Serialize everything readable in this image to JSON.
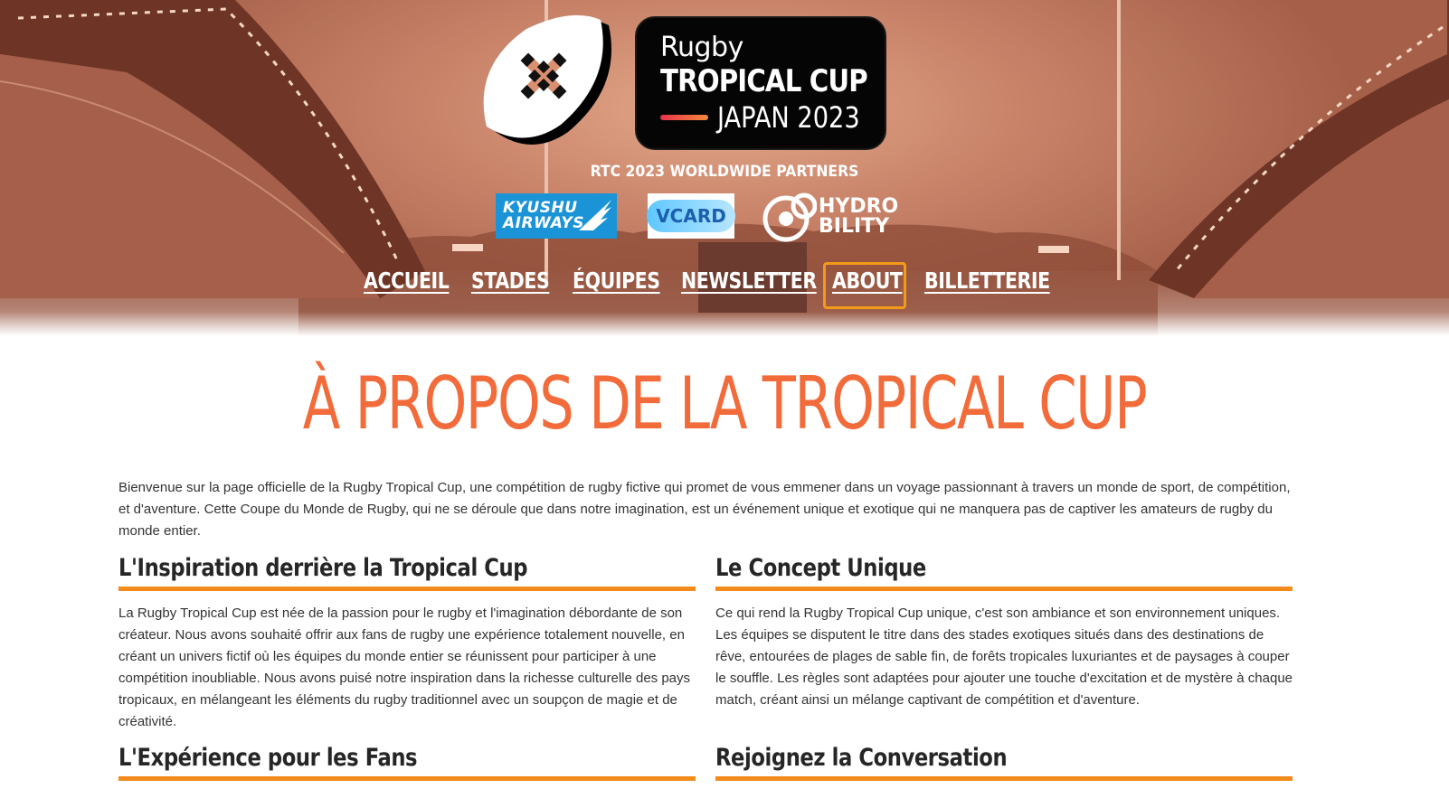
{
  "hero": {
    "logo": {
      "line1": "Rugby",
      "line2": "TROPICAL CUP",
      "line3": "JAPAN 2023"
    },
    "partners_title": "RTC 2023 WORLDWIDE PARTNERS",
    "partners": [
      {
        "name": "KYUSHU AIRWAYS",
        "line1": "KYUSHU",
        "line2": "AIRWAYS"
      },
      {
        "name": "VCARD",
        "label": "VCARD"
      },
      {
        "name": "HYDRO BILITY",
        "line1": "HYDRO",
        "line2": "BILITY"
      }
    ]
  },
  "nav": {
    "items": [
      {
        "label": "ACCUEIL"
      },
      {
        "label": "STADES"
      },
      {
        "label": "ÉQUIPES"
      },
      {
        "label": "NEWSLETTER"
      },
      {
        "label": "ABOUT",
        "active": true
      },
      {
        "label": "BILLETTERIE"
      }
    ],
    "focus_color": "#f39a19"
  },
  "main": {
    "title": "À PROPOS DE LA TROPICAL CUP",
    "intro": "Bienvenue sur la page officielle de la Rugby Tropical Cup, une compétition de rugby fictive qui promet de vous emmener dans un voyage passionnant à travers un monde de sport, de compétition, et d'aventure. Cette Coupe du Monde de Rugby, qui ne se déroule que dans notre imagination, est un événement unique et exotique qui ne manquera pas de captiver les amateurs de rugby du monde entier.",
    "sections": [
      {
        "heading": "L'Inspiration derrière la Tropical Cup",
        "text": "La Rugby Tropical Cup est née de la passion pour le rugby et l'imagination débordante de son créateur. Nous avons souhaité offrir aux fans de rugby une expérience totalement nouvelle, en créant un univers fictif où les équipes du monde entier se réunissent pour participer à une compétition inoubliable. Nous avons puisé notre inspiration dans la richesse culturelle des pays tropicaux, en mélangeant les éléments du rugby traditionnel avec un soupçon de magie et de créativité."
      },
      {
        "heading": "Le Concept Unique",
        "text": "Ce qui rend la Rugby Tropical Cup unique, c'est son ambiance et son environnement uniques. Les équipes se disputent le titre dans des stades exotiques situés dans des destinations de rêve, entourées de plages de sable fin, de forêts tropicales luxuriantes et de paysages à couper le souffle. Les règles sont adaptées pour ajouter une touche d'excitation et de mystère à chaque match, créant ainsi un mélange captivant de compétition et d'aventure."
      },
      {
        "heading": "L'Expérience pour les Fans",
        "text": ""
      },
      {
        "heading": "Rejoignez la Conversation",
        "text": ""
      }
    ]
  },
  "colors": {
    "accent": "#f28a1c",
    "title": "#f26b3a",
    "hero_tint": "#c9846a"
  }
}
